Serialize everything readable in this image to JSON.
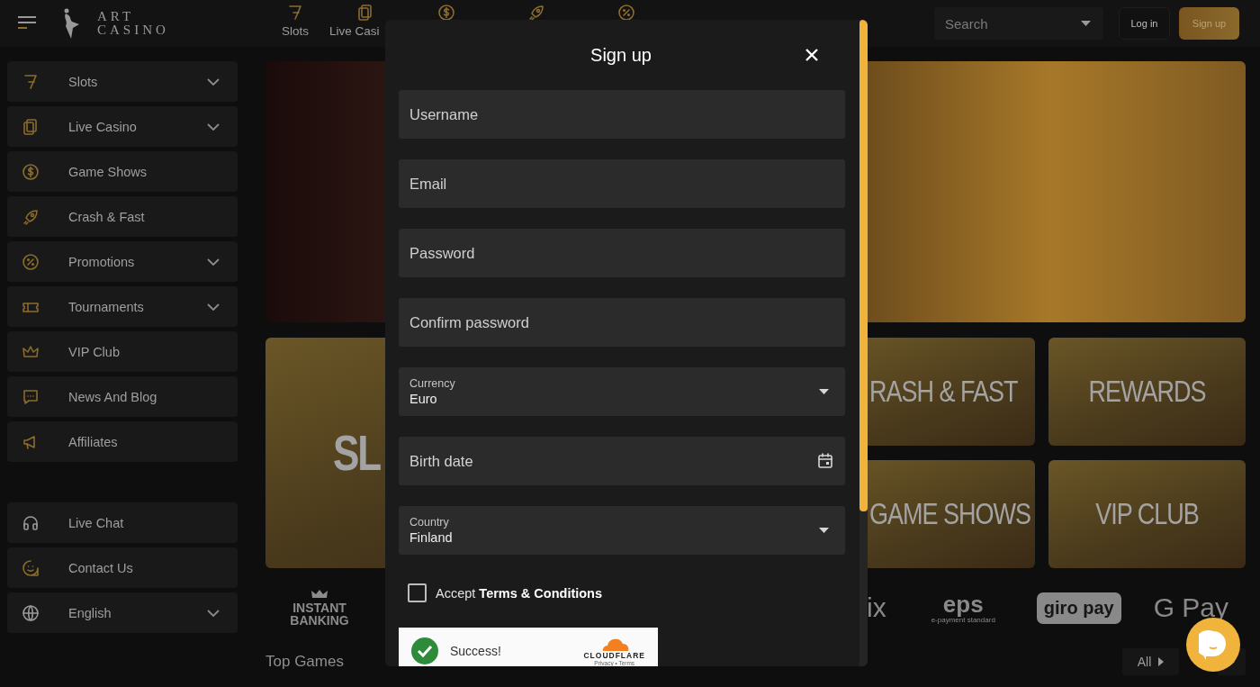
{
  "header": {
    "brand_line_1": "ART",
    "brand_line_2": "CASINO",
    "nav": [
      {
        "kind": "labeled",
        "label": "Slots"
      },
      {
        "kind": "labeled",
        "label": "Live Casi"
      },
      {
        "kind": "icon_only"
      },
      {
        "kind": "icon_only"
      },
      {
        "kind": "icon_only"
      }
    ],
    "search": {
      "placeholder": "Search"
    },
    "login": "Log in",
    "signup": "Sign up"
  },
  "sidebar": {
    "items": [
      {
        "label": "Slots",
        "has_submenu": true
      },
      {
        "label": "Live Casino",
        "has_submenu": true
      },
      {
        "label": "Game Shows",
        "has_submenu": false
      },
      {
        "label": "Crash & Fast",
        "has_submenu": false
      },
      {
        "label": "Promotions",
        "has_submenu": true
      },
      {
        "label": "Tournaments",
        "has_submenu": true
      },
      {
        "label": "VIP Club",
        "has_submenu": false
      },
      {
        "label": "News And Blog",
        "has_submenu": false
      },
      {
        "label": "Affiliates",
        "has_submenu": false
      }
    ],
    "bottom_items": [
      {
        "label": "Live Chat",
        "has_submenu": false
      },
      {
        "label": "Contact Us",
        "has_submenu": false
      },
      {
        "label": "English",
        "has_submenu": true
      }
    ]
  },
  "tiles": [
    {
      "title": "SL"
    },
    {
      "title": "RASH & FAST"
    },
    {
      "title": "REWARDS"
    },
    {
      "title": "GAME SHOWS"
    },
    {
      "title": "VIP CLUB"
    }
  ],
  "payment_methods": [
    {
      "kind": "banking",
      "label": "INSTANT BANKING"
    },
    {
      "kind": "wordmark",
      "label": "ix"
    },
    {
      "kind": "eps",
      "label": "eps",
      "sublabel": "e-payment standard"
    },
    {
      "kind": "badge",
      "label": "giro pay"
    },
    {
      "kind": "wordmark",
      "label": "G Pay"
    }
  ],
  "top_games": {
    "title": "Top Games",
    "all_button": "All"
  },
  "signup_modal": {
    "title": "Sign up",
    "fields": [
      {
        "kind": "text",
        "placeholder": "Username"
      },
      {
        "kind": "text",
        "placeholder": "Email"
      },
      {
        "kind": "password",
        "placeholder": "Password"
      },
      {
        "kind": "password",
        "placeholder": "Confirm password"
      },
      {
        "kind": "select",
        "label": "Currency",
        "value": "Euro"
      },
      {
        "kind": "date",
        "placeholder": "Birth date"
      },
      {
        "kind": "select",
        "label": "Country",
        "value": "Finland"
      }
    ],
    "terms": {
      "text": "Accept **Terms & Conditions**",
      "checked": false
    },
    "captcha": {
      "status": "Success!",
      "brand": "CLOUDFLARE",
      "links": "Privacy • Terms"
    }
  }
}
